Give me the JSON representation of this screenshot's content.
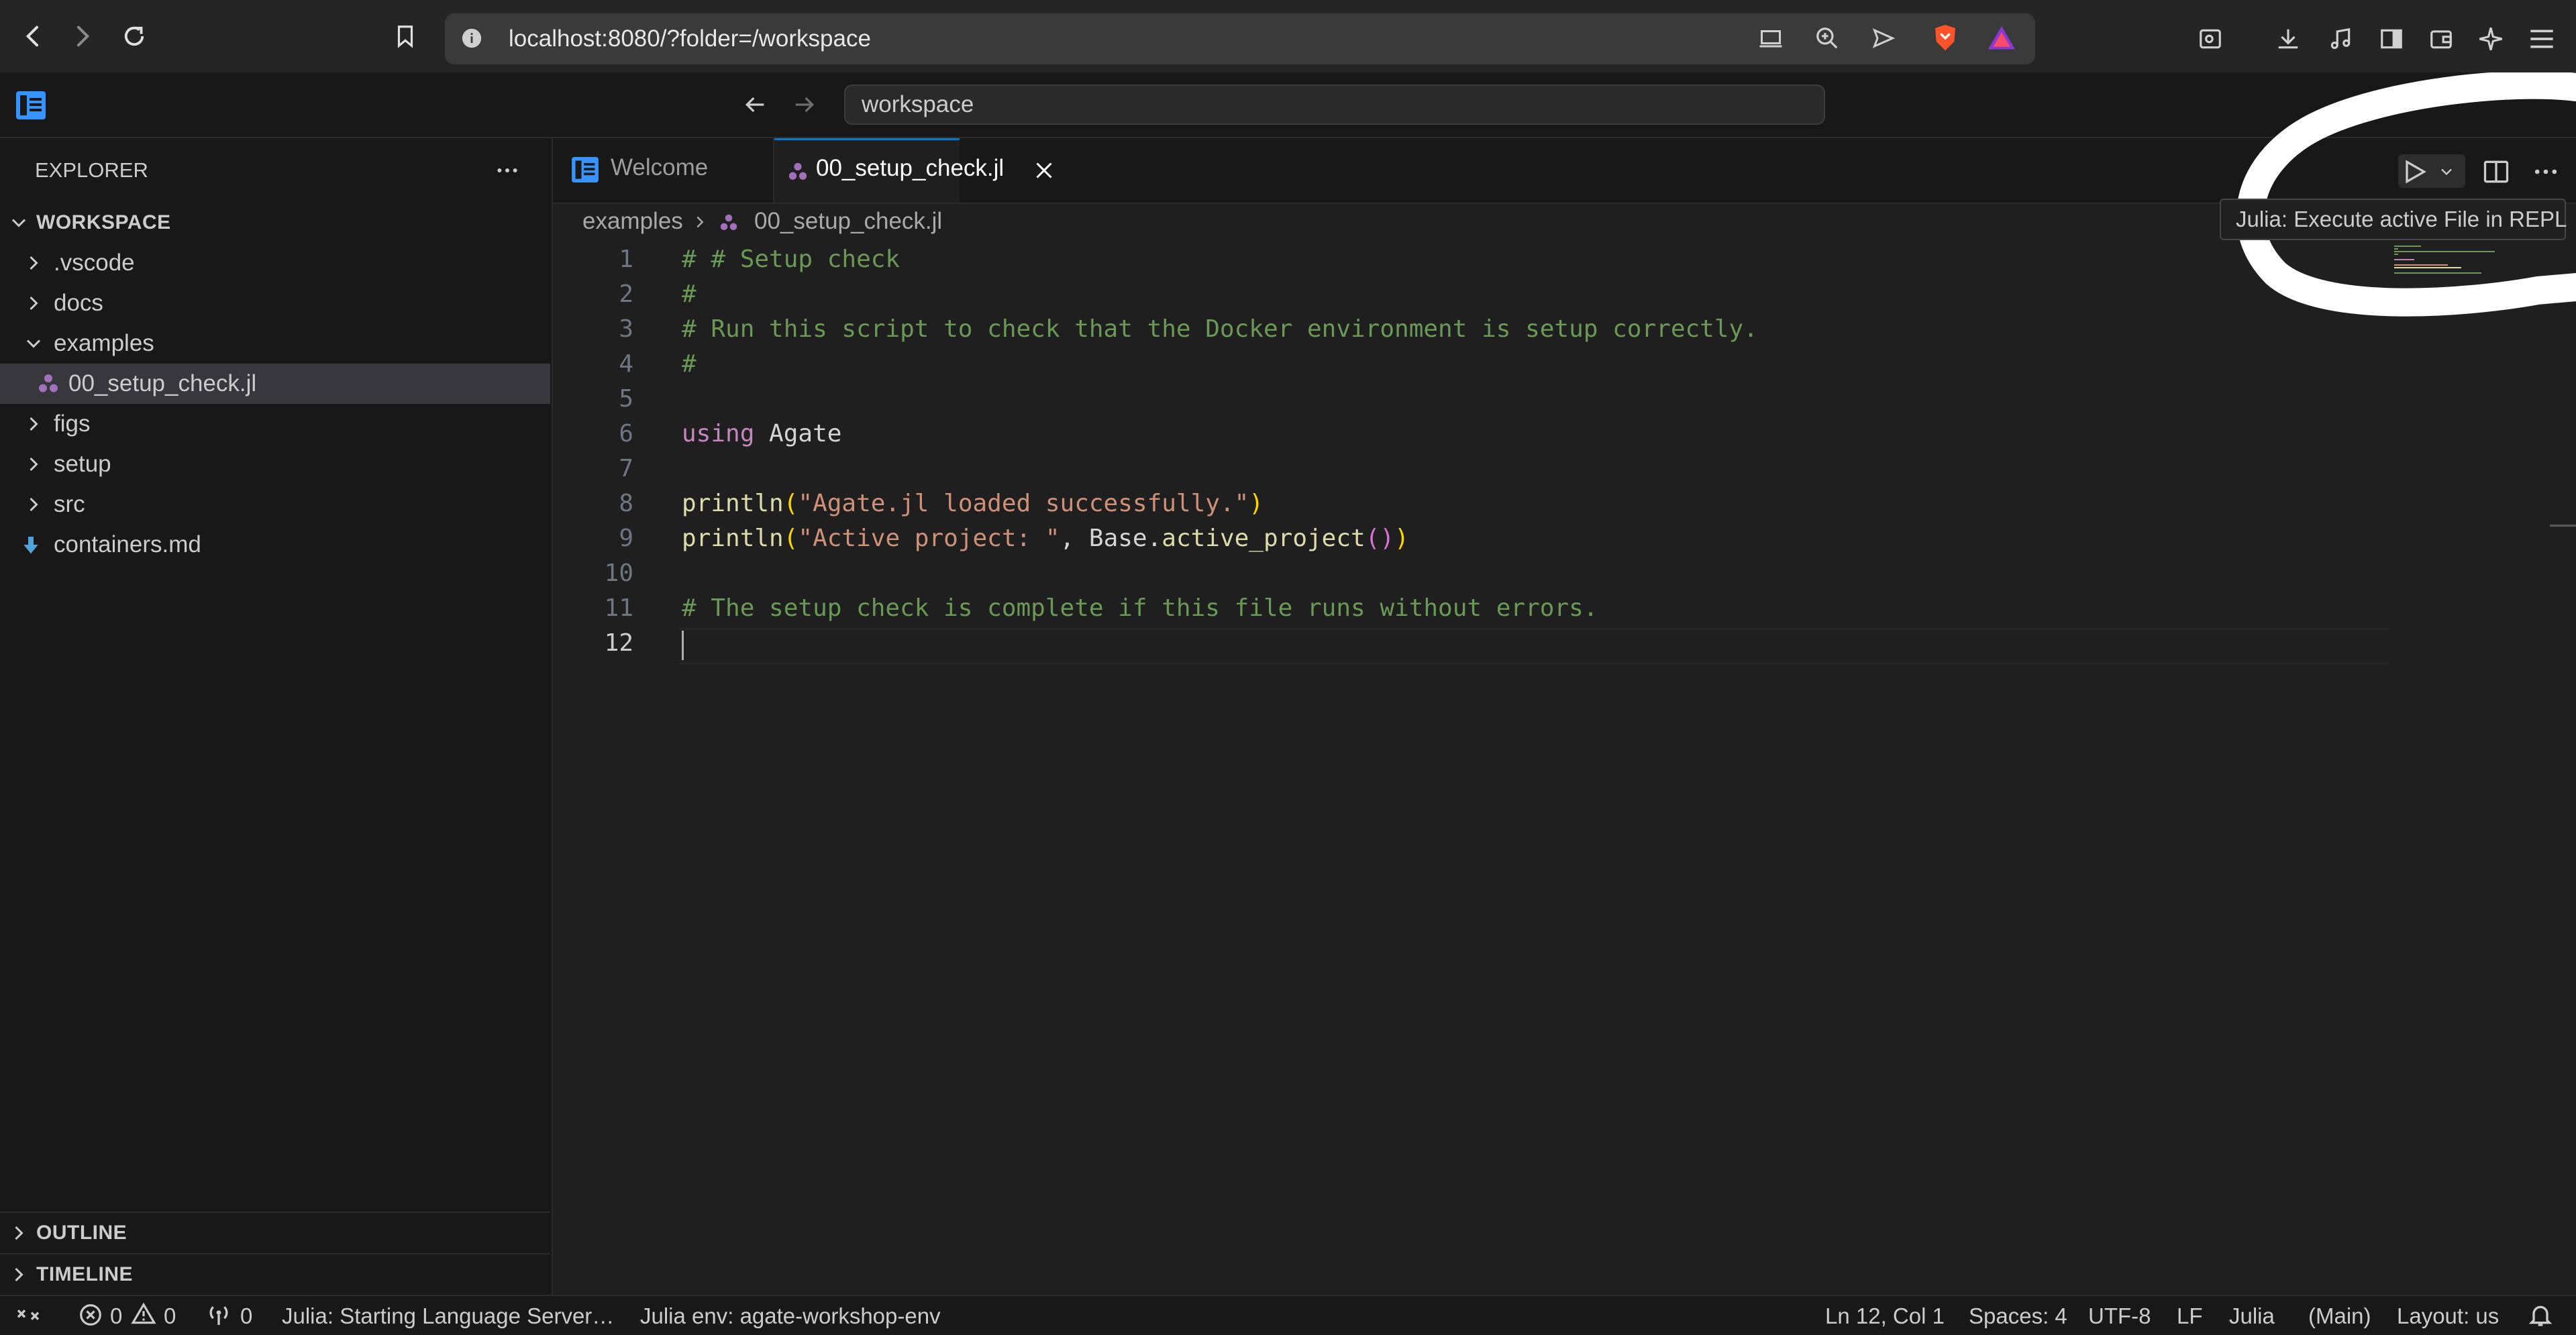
{
  "browser": {
    "url": "localhost:8080/?folder=/workspace"
  },
  "titlebar": {
    "search_text": "workspace"
  },
  "explorer": {
    "title": "EXPLORER",
    "workspace_label": "WORKSPACE",
    "items": [
      {
        "label": ".vscode",
        "type": "folder",
        "expanded": false
      },
      {
        "label": "docs",
        "type": "folder",
        "expanded": false
      },
      {
        "label": "examples",
        "type": "folder",
        "expanded": true
      },
      {
        "label": "00_setup_check.jl",
        "type": "julia-file",
        "selected": true
      },
      {
        "label": "figs",
        "type": "folder",
        "expanded": false
      },
      {
        "label": "setup",
        "type": "folder",
        "expanded": false
      },
      {
        "label": "src",
        "type": "folder",
        "expanded": false
      },
      {
        "label": "containers.md",
        "type": "markdown-file"
      }
    ],
    "outline_label": "OUTLINE",
    "timeline_label": "TIMELINE"
  },
  "tabs": [
    {
      "label": "Welcome",
      "active": false
    },
    {
      "label": "00_setup_check.jl",
      "active": true
    }
  ],
  "breadcrumbs": [
    "examples",
    "00_setup_check.jl"
  ],
  "editor": {
    "line_numbers": [
      "1",
      "2",
      "3",
      "4",
      "5",
      "6",
      "7",
      "8",
      "9",
      "10",
      "11",
      "12"
    ],
    "lines": [
      "# # Setup check",
      "#",
      "# Run this script to check that the Docker environment is setup correctly.",
      "#",
      "",
      "using Agate",
      "",
      "println(\"Agate.jl loaded successfully.\")",
      "println(\"Active project: \", Base.active_project())",
      "",
      "# The setup check is complete if this file runs without errors.",
      ""
    ]
  },
  "tooltip": {
    "text": "Julia: Execute active File in REPL"
  },
  "statusbar": {
    "errors": "0",
    "warnings": "0",
    "ports": "0",
    "language_server": "Julia: Starting Language Server…",
    "julia_env": "Julia env: agate-workshop-env",
    "cursor": "Ln 12, Col 1",
    "spaces": "Spaces: 4",
    "encoding": "UTF-8",
    "eol": "LF",
    "language": "Julia",
    "module": "(Main)",
    "layout": "Layout: us"
  },
  "colors": {
    "accent": "#0078d4",
    "comment": "#6a9955",
    "keyword": "#c586c0",
    "string": "#ce9178",
    "function": "#dcdcaa",
    "julia_icon": "#a270ba"
  }
}
